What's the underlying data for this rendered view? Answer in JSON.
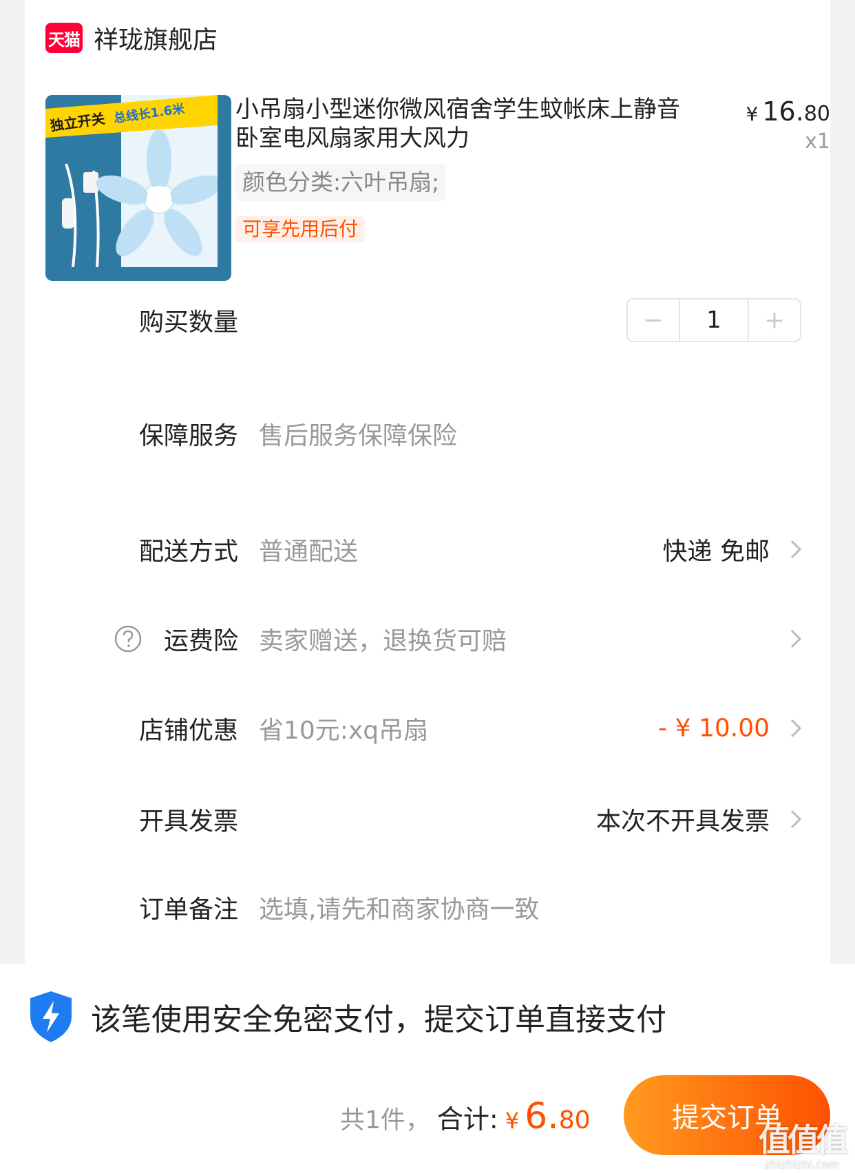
{
  "store": {
    "badge": "天猫",
    "name": "祥珑旗舰店"
  },
  "product": {
    "image_text_1": "独立开关",
    "image_text_2": "总线长1.6米",
    "title": "小吊扇小型迷你微风宿舍学生蚊帐床上静音卧室电风扇家用大风力",
    "price_symbol": "¥",
    "price_int": "16.",
    "price_dec": "80",
    "quantity_label": "x1",
    "sku": "颜色分类:六叶吊扇;",
    "tag": "可享先用后付"
  },
  "rows": {
    "quantity": {
      "label": "购买数量",
      "value": "1",
      "minus": "−",
      "plus": "+"
    },
    "guarantee": {
      "label": "保障服务",
      "value": "售后服务保障保险"
    },
    "delivery": {
      "label": "配送方式",
      "value": "普通配送",
      "right": "快递 免邮"
    },
    "shipping_insurance": {
      "label": "运费险",
      "value": "卖家赠送，退换货可赔"
    },
    "store_discount": {
      "label": "店铺优惠",
      "value": "省10元:xq吊扇",
      "right": "- ¥ 10.00"
    },
    "invoice": {
      "label": "开具发票",
      "right": "本次不开具发票"
    },
    "remark": {
      "label": "订单备注",
      "placeholder": "选填,请先和商家协商一致"
    }
  },
  "footer": {
    "secure_text": "该笔使用安全免密支付，提交订单直接支付",
    "count_text": "共1件，",
    "total_label": "合计:",
    "total_symbol": "¥",
    "total_int": "6.",
    "total_dec": "80",
    "submit_label": "提交订单"
  },
  "watermark": {
    "main": "值值值",
    "sub": "zhizhizhi.com"
  },
  "colors": {
    "accent": "#ff5000",
    "tmall_red": "#ff0036",
    "shield_blue": "#1e7bf0"
  }
}
